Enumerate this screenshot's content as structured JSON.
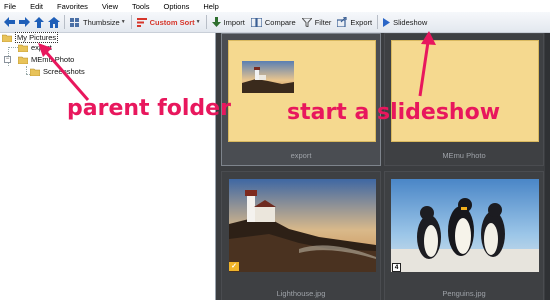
{
  "menu": [
    "File",
    "Edit",
    "Favorites",
    "View",
    "Tools",
    "Options",
    "Help"
  ],
  "toolbar": {
    "thumbsize_label": "Thumbsize",
    "custom_sort_label": "Custom Sort",
    "import_label": "Import",
    "compare_label": "Compare",
    "filter_label": "Filter",
    "export_label": "Export",
    "slideshow_label": "Slideshow"
  },
  "tree": {
    "root": "My Pictures",
    "children": [
      {
        "label": "export"
      },
      {
        "label": "MEmu Photo",
        "children": [
          {
            "label": "Screenshots"
          }
        ]
      }
    ]
  },
  "gallery": {
    "items": [
      {
        "name": "export",
        "kind": "folder"
      },
      {
        "name": "MEmu Photo",
        "kind": "folder"
      },
      {
        "name": "Lighthouse.jpg",
        "kind": "image",
        "badge": "✓"
      },
      {
        "name": "Penguins.jpg",
        "kind": "image",
        "badge": "4"
      }
    ]
  },
  "annotations": {
    "parent_folder": "parent folder",
    "slideshow": "start a slideshow"
  },
  "colors": {
    "annotation": "#e8175d",
    "folder_fill": "#f5d98f",
    "gallery_bg": "#3b3d40",
    "custom_sort": "#d6372b"
  }
}
